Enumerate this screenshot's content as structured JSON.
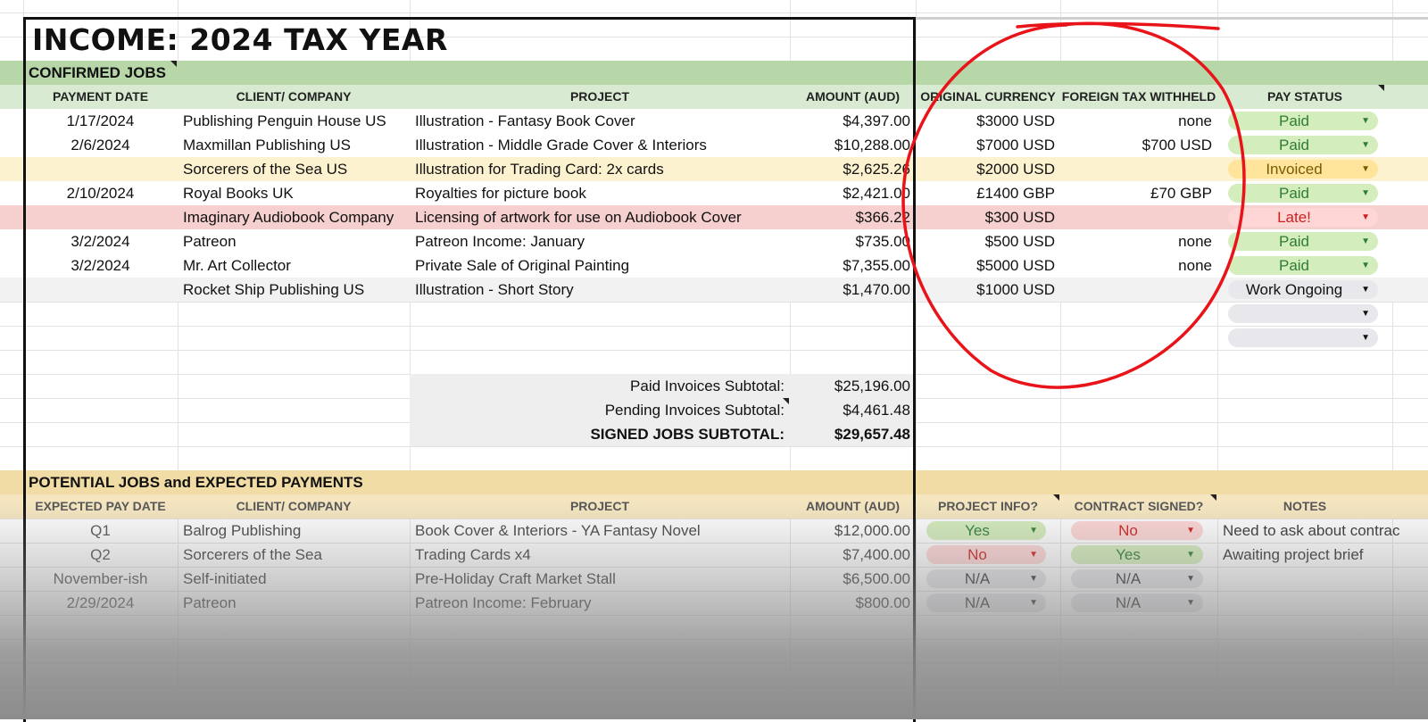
{
  "title": "INCOME: 2024 TAX YEAR",
  "confirmed": {
    "section_label": "CONFIRMED JOBS",
    "headers": [
      "PAYMENT DATE",
      "CLIENT/ COMPANY",
      "PROJECT",
      "AMOUNT (AUD)",
      "ORIGINAL CURRENCY",
      "FOREIGN TAX WITHHELD",
      "PAY STATUS"
    ],
    "rows": [
      {
        "date": "1/17/2024",
        "client": "Publishing Penguin House US",
        "project": "Illustration - Fantasy Book Cover",
        "amount": "$4,397.00",
        "orig": "$3000 USD",
        "tax": "none",
        "status": "Paid",
        "status_kind": "paid",
        "band": "#ffffff"
      },
      {
        "date": "2/6/2024",
        "client": "Maxmillan Publishing US",
        "project": "Illustration - Middle Grade Cover & Interiors",
        "amount": "$10,288.00",
        "orig": "$7000 USD",
        "tax": "$700 USD",
        "status": "Paid",
        "status_kind": "paid",
        "band": "#ffffff"
      },
      {
        "date": "",
        "client": "Sorcerers of the Sea US",
        "project": "Illustration for Trading Card: 2x cards",
        "amount": "$2,625.26",
        "orig": "$2000 USD",
        "tax": "",
        "status": "Invoiced",
        "status_kind": "invoiced",
        "band": "#fdf2d0"
      },
      {
        "date": "2/10/2024",
        "client": "Royal Books UK",
        "project": "Royalties for picture book",
        "amount": "$2,421.00",
        "orig": "£1400 GBP",
        "tax": "£70 GBP",
        "status": "Paid",
        "status_kind": "paid",
        "band": "#ffffff"
      },
      {
        "date": "",
        "client": "Imaginary Audiobook Company",
        "project": "Licensing of artwork for use on Audiobook Cover",
        "amount": "$366.22",
        "orig": "$300 USD",
        "tax": "",
        "status": "Late!",
        "status_kind": "late",
        "band": "#f6cfcf"
      },
      {
        "date": "3/2/2024",
        "client": "Patreon",
        "project": "Patreon Income: January",
        "amount": "$735.00",
        "orig": "$500 USD",
        "tax": "none",
        "status": "Paid",
        "status_kind": "paid",
        "band": "#ffffff"
      },
      {
        "date": "3/2/2024",
        "client": "Mr. Art Collector",
        "project": "Private Sale of Original Painting",
        "amount": "$7,355.00",
        "orig": "$5000 USD",
        "tax": "none",
        "status": "Paid",
        "status_kind": "paid",
        "band": "#ffffff"
      },
      {
        "date": "",
        "client": "Rocket Ship Publishing US",
        "project": "Illustration - Short Story",
        "amount": "$1,470.00",
        "orig": "$1000 USD",
        "tax": "",
        "status": "Work Ongoing",
        "status_kind": "ongoing",
        "band": "#f2f2f2"
      }
    ],
    "empty_status_count": 2
  },
  "subtotals": [
    {
      "label": "Paid Invoices Subtotal:",
      "value": "$25,196.00",
      "bold": false
    },
    {
      "label": "Pending Invoices Subtotal:",
      "value": "$4,461.48",
      "bold": false
    },
    {
      "label": "SIGNED JOBS SUBTOTAL:",
      "value": "$29,657.48",
      "bold": true
    }
  ],
  "potential": {
    "section_label": "POTENTIAL JOBS and EXPECTED PAYMENTS",
    "headers": [
      "EXPECTED PAY DATE",
      "CLIENT/ COMPANY",
      "PROJECT",
      "AMOUNT (AUD)",
      "PROJECT INFO?",
      "CONTRACT SIGNED?",
      "NOTES"
    ],
    "rows": [
      {
        "date": "Q1",
        "client": "Balrog Publishing",
        "project": "Book Cover & Interiors - YA Fantasy Novel",
        "amount": "$12,000.00",
        "info": "Yes",
        "info_kind": "yes",
        "signed": "No",
        "signed_kind": "no",
        "notes": "Need to ask about contrac"
      },
      {
        "date": "Q2",
        "client": "Sorcerers of the Sea",
        "project": "Trading Cards x4",
        "amount": "$7,400.00",
        "info": "No",
        "info_kind": "no",
        "signed": "Yes",
        "signed_kind": "yes",
        "notes": "Awaiting project brief"
      },
      {
        "date": "November-ish",
        "client": "Self-initiated",
        "project": "Pre-Holiday Craft Market Stall",
        "amount": "$6,500.00",
        "info": "N/A",
        "info_kind": "na",
        "signed": "N/A",
        "signed_kind": "na",
        "notes": ""
      },
      {
        "date": "2/29/2024",
        "client": "Patreon",
        "project": "Patreon Income: February",
        "amount": "$800.00",
        "info": "N/A",
        "info_kind": "na",
        "signed": "N/A",
        "signed_kind": "na",
        "notes": ""
      }
    ]
  },
  "colors": {
    "section_green": "#b7d7a8",
    "header_green": "#d9ead3",
    "section_gold": "#f1dca6",
    "header_gold": "#f5e6c0",
    "paid_bg": "#d4edbc",
    "paid_fg": "#2f7d32",
    "invoiced_bg": "#ffe49c",
    "invoiced_fg": "#7a5a00",
    "late_bg": "#ffd6d6",
    "late_fg": "#cc1f1f",
    "ongoing_bg": "#e8e8ec",
    "ongoing_fg": "#111111",
    "annotation_red": "#e8141a"
  },
  "icons": {
    "dropdown": "caret-down-icon",
    "annotation": "red-hand-drawn-circle"
  }
}
